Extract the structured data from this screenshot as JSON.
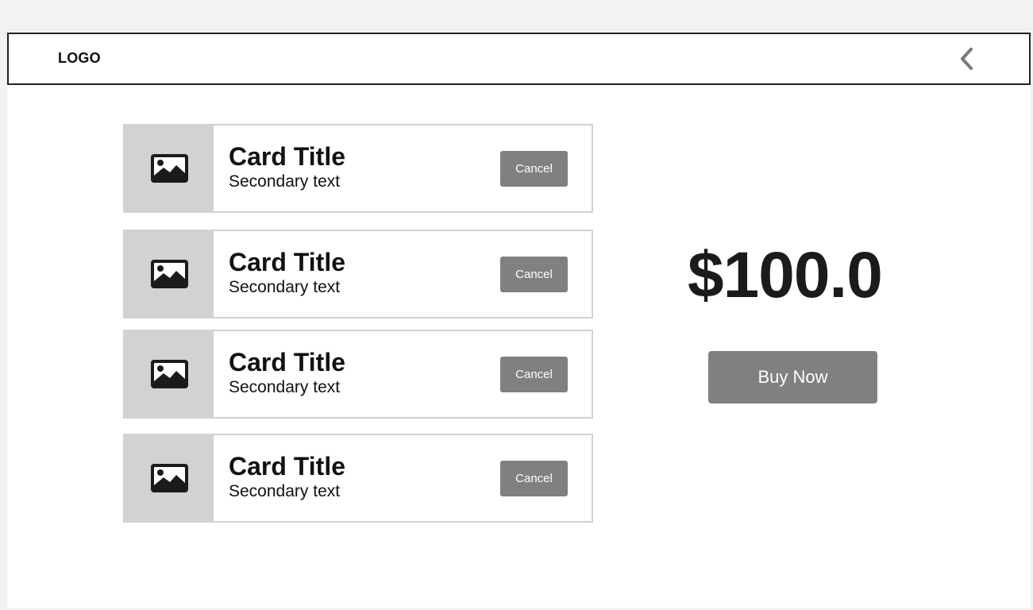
{
  "header": {
    "logo": "LOGO",
    "back_icon": "chevron-left-icon"
  },
  "cards": [
    {
      "title": "Card Title",
      "secondary": "Secondary text",
      "action_label": "Cancel",
      "thumb_icon": "image-icon"
    },
    {
      "title": "Card Title",
      "secondary": "Secondary text",
      "action_label": "Cancel",
      "thumb_icon": "image-icon"
    },
    {
      "title": "Card Title",
      "secondary": "Secondary text",
      "action_label": "Cancel",
      "thumb_icon": "image-icon"
    },
    {
      "title": "Card Title",
      "secondary": "Secondary text",
      "action_label": "Cancel",
      "thumb_icon": "image-icon"
    }
  ],
  "summary": {
    "price": "$100.0",
    "buy_label": "Buy Now"
  },
  "colors": {
    "page_background": "#f2f2f2",
    "button_gray": "#808080",
    "thumb_gray": "#d2d2d2",
    "card_border": "#d2d2d2",
    "header_border": "#222222"
  }
}
